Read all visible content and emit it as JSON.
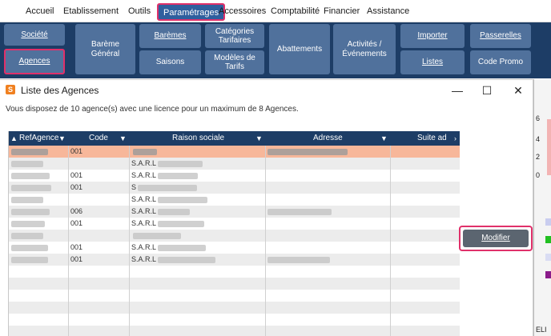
{
  "menu": {
    "items": [
      "Accueil",
      "Etablissement",
      "Outils",
      "Paramétrages",
      "Accessoires",
      "Comptabilité",
      "Financier",
      "Assistance"
    ],
    "active": "Paramétrages"
  },
  "ribbon": {
    "societe": "Société",
    "agences": "Agences",
    "bareme_general_1": "Barème",
    "bareme_general_2": "Général",
    "baremes": "Barèmes",
    "saisons": "Saisons",
    "categories_1": "Catégories",
    "categories_2": "Tarifaires",
    "modeles_1": "Modèles de",
    "modeles_2": "Tarifs",
    "abattements": "Abattements",
    "activites_1": "Activités /",
    "activites_2": "Événements",
    "importer": "Importer",
    "listes": "Listes",
    "passerelles": "Passerelles",
    "code_promo": "Code Promo"
  },
  "dialog": {
    "title": "Liste des Agences",
    "minimize": "—",
    "maximize": "☐",
    "close": "✕",
    "info": "Vous disposez de 10 agence(s) avec une licence pour un maximum de 8 Agences."
  },
  "grid": {
    "columns": [
      "RefAgence",
      "Code",
      "Raison sociale",
      "Adresse",
      "Suite ad"
    ],
    "rows": [
      {
        "code": "001",
        "selected": true
      },
      {
        "code": "",
        "raison": "S.A.R.L"
      },
      {
        "code": "001",
        "raison": "S.A.R.L"
      },
      {
        "code": "001",
        "raison": "S"
      },
      {
        "code": "",
        "raison": "S.A.R.L"
      },
      {
        "code": "006",
        "raison": "S.A.R.L"
      },
      {
        "code": "001",
        "raison": "S.A.R.L"
      },
      {
        "code": "",
        "raison": ""
      },
      {
        "code": "001",
        "raison": "S.A.R.L"
      },
      {
        "code": "001",
        "raison": "S.A.R.L"
      }
    ]
  },
  "modifier_label": "Modifier",
  "side": {
    "num_top": "6",
    "num_mid": "4",
    "num_low": "2",
    "num_bottom": "0",
    "bottom_text": "ELI"
  },
  "colors": {
    "ribbon_bg": "#1d3d66",
    "button_bg": "#50719c",
    "highlight": "#e0306a",
    "selected_row": "#f7b79a",
    "grid_header": "#1d3d66"
  }
}
